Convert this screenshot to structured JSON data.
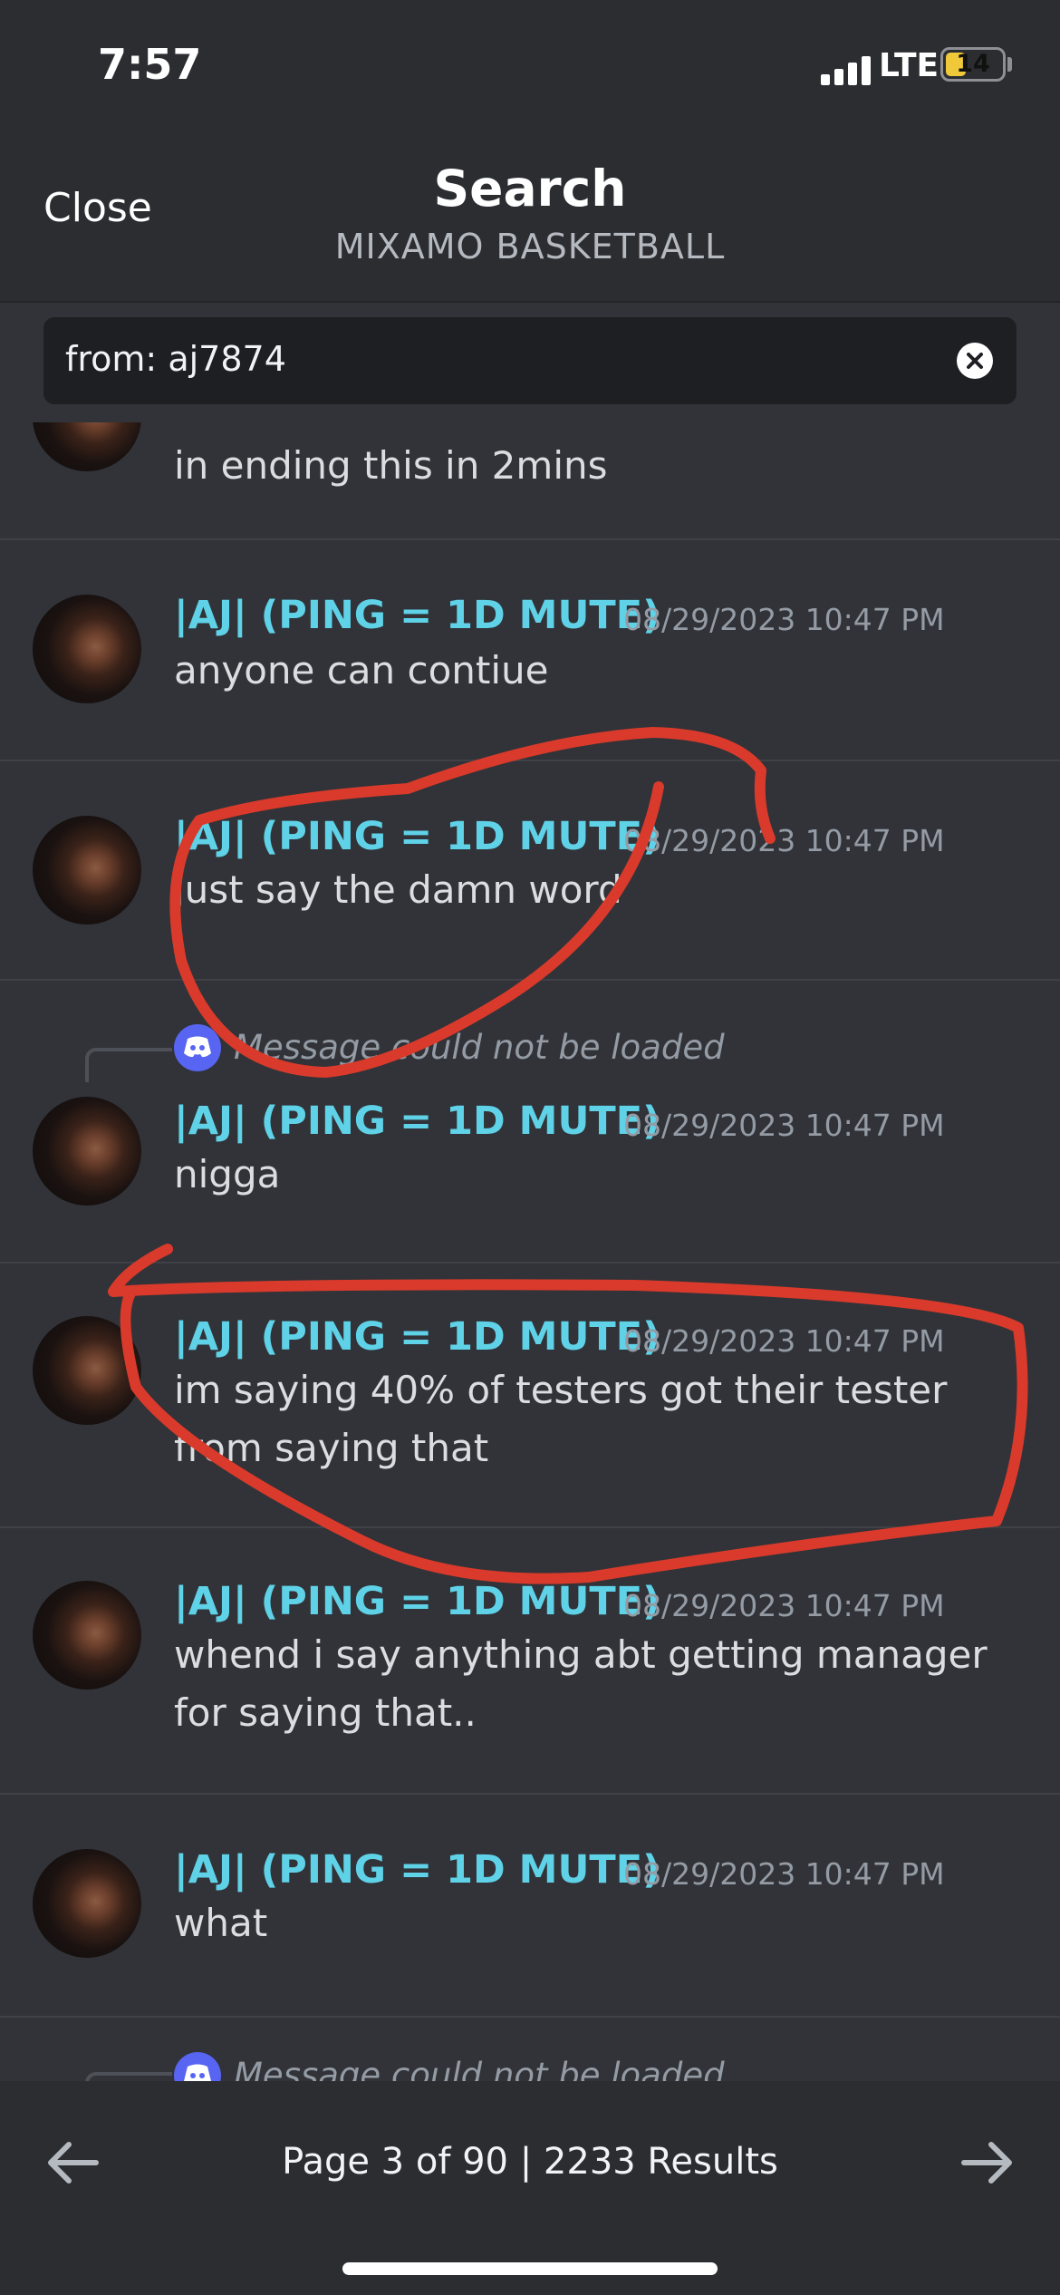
{
  "status_bar": {
    "time": "7:57",
    "network": "LTE",
    "battery": "14",
    "battery_color": "#f0c93a"
  },
  "header": {
    "close_label": "Close",
    "title": "Search",
    "subtitle": "MIXAMO BASKETBALL"
  },
  "search": {
    "value": "from: aj7874"
  },
  "colors": {
    "author": "#5fd2e8",
    "background": "#313338",
    "annotation": "#d93a2b"
  },
  "messages": [
    {
      "body": "in ending this in 2mins"
    },
    {
      "author": "|AJ| (PING = 1D MUTE)",
      "timestamp": "08/29/2023 10:47 PM",
      "body": "anyone can contiue"
    },
    {
      "author": "|AJ| (PING = 1D MUTE)",
      "timestamp": "08/29/2023 10:47 PM",
      "body": "just say the damn word"
    },
    {
      "reply": "Message could not be loaded",
      "author": "|AJ| (PING = 1D MUTE)",
      "timestamp": "08/29/2023 10:47 PM",
      "body": "nigga"
    },
    {
      "author": "|AJ| (PING = 1D MUTE)",
      "timestamp": "08/29/2023 10:47 PM",
      "body": "im saying 40% of testers got their tester from saying that"
    },
    {
      "author": "|AJ| (PING = 1D MUTE)",
      "timestamp": "08/29/2023 10:47 PM",
      "body": "whend i say anything abt getting manager for saying that.."
    },
    {
      "author": "|AJ| (PING = 1D MUTE)",
      "timestamp": "08/29/2023 10:47 PM",
      "body": "what"
    },
    {
      "reply": "Message could not be loaded"
    }
  ],
  "footer": {
    "pagination": "Page 3 of 90  |  2233 Results"
  }
}
